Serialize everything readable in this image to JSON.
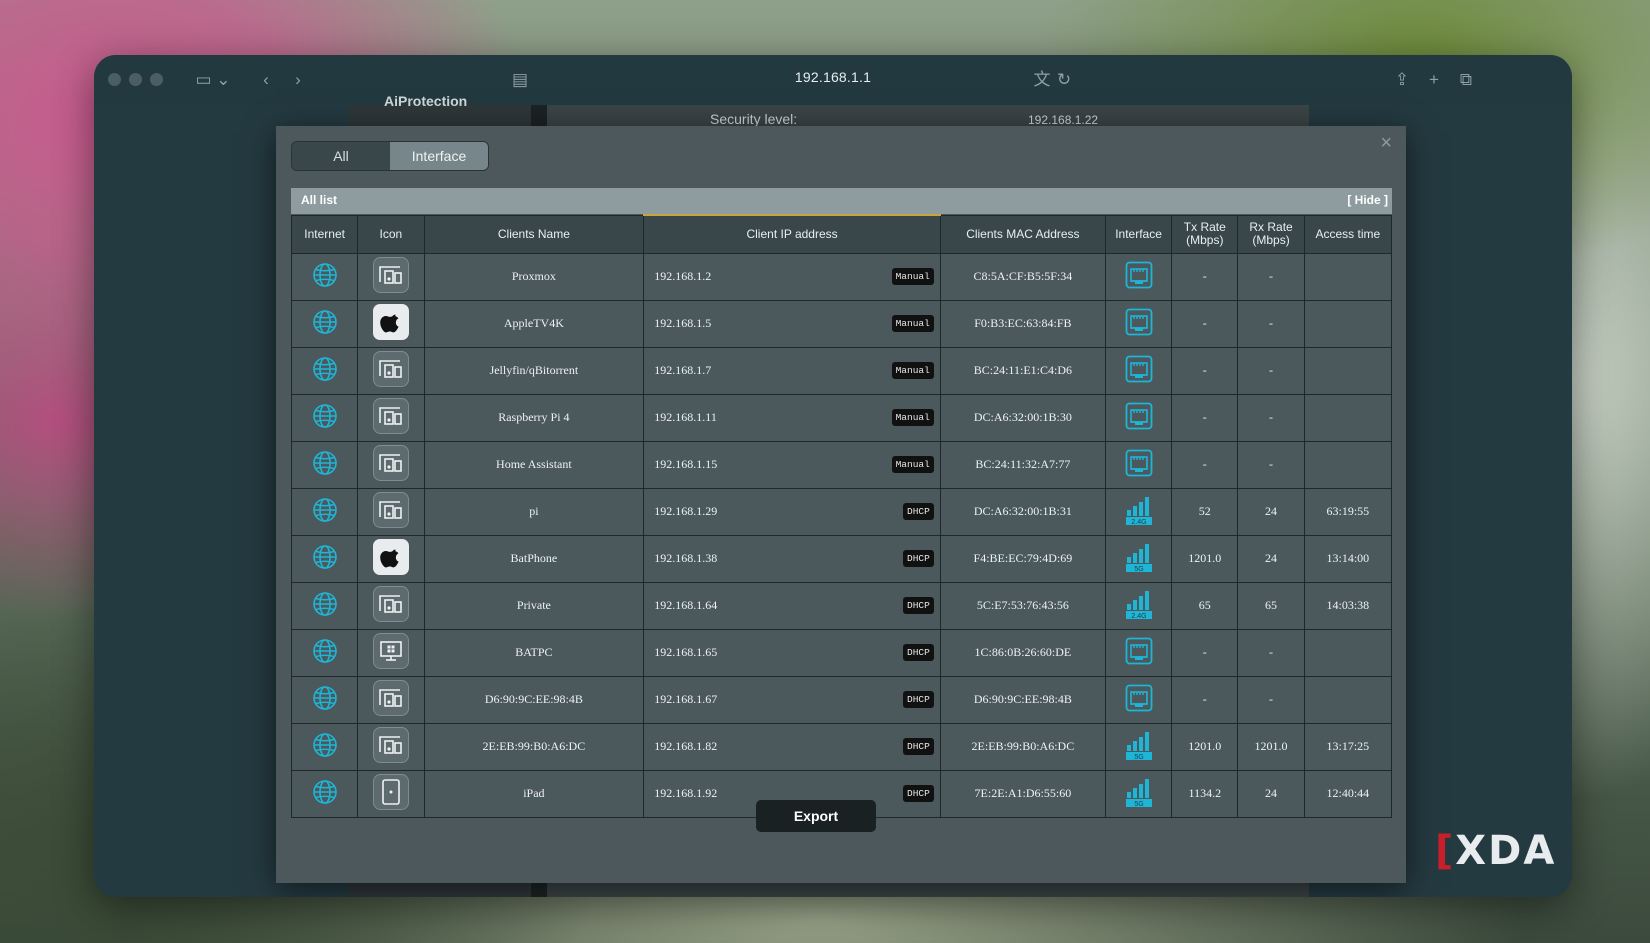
{
  "browser": {
    "url": "192.168.1.1"
  },
  "background_page": {
    "sidebar_item": "AiProtection",
    "security_label": "Security level:",
    "ip_fragment": "192.168.1.22"
  },
  "modal": {
    "tabs": [
      {
        "label": "All",
        "active": false
      },
      {
        "label": "Interface",
        "active": true
      }
    ],
    "list_title": "All list",
    "hide_label": "[ Hide ]",
    "export_label": "Export"
  },
  "table": {
    "headers": [
      "Internet",
      "Icon",
      "Clients Name",
      "Client IP address",
      "Clients MAC Address",
      "Interface",
      "Tx Rate (Mbps)",
      "Rx Rate (Mbps)",
      "Access time"
    ],
    "rows": [
      {
        "icon": "device-icon",
        "name": "Proxmox",
        "ip": "192.168.1.2",
        "mode": "Manual",
        "mac": "C8:5A:CF:B5:5F:34",
        "interface": "ethernet",
        "tx": "-",
        "rx": "-",
        "time": ""
      },
      {
        "icon": "apple-icon",
        "name": "AppleTV4K",
        "ip": "192.168.1.5",
        "mode": "Manual",
        "mac": "F0:B3:EC:63:84:FB",
        "interface": "ethernet",
        "tx": "-",
        "rx": "-",
        "time": ""
      },
      {
        "icon": "device-icon",
        "name": "Jellyfin/qBitorrent",
        "ip": "192.168.1.7",
        "mode": "Manual",
        "mac": "BC:24:11:E1:C4:D6",
        "interface": "ethernet",
        "tx": "-",
        "rx": "-",
        "time": ""
      },
      {
        "icon": "device-icon",
        "name": "Raspberry Pi 4",
        "ip": "192.168.1.11",
        "mode": "Manual",
        "mac": "DC:A6:32:00:1B:30",
        "interface": "ethernet",
        "tx": "-",
        "rx": "-",
        "time": ""
      },
      {
        "icon": "device-icon",
        "name": "Home Assistant",
        "ip": "192.168.1.15",
        "mode": "Manual",
        "mac": "BC:24:11:32:A7:77",
        "interface": "ethernet",
        "tx": "-",
        "rx": "-",
        "time": ""
      },
      {
        "icon": "device-icon",
        "name": "pi",
        "ip": "192.168.1.29",
        "mode": "DHCP",
        "mac": "DC:A6:32:00:1B:31",
        "interface": "wifi",
        "band": "2.4G",
        "tx": "52",
        "rx": "24",
        "time": "63:19:55"
      },
      {
        "icon": "apple-icon",
        "name": "BatPhone",
        "ip": "192.168.1.38",
        "mode": "DHCP",
        "mac": "F4:BE:EC:79:4D:69",
        "interface": "wifi",
        "band": "5G",
        "tx": "1201.0",
        "rx": "24",
        "time": "13:14:00"
      },
      {
        "icon": "device-icon",
        "name": "Private",
        "ip": "192.168.1.64",
        "mode": "DHCP",
        "mac": "5C:E7:53:76:43:56",
        "interface": "wifi",
        "band": "2.4G",
        "tx": "65",
        "rx": "65",
        "time": "14:03:38"
      },
      {
        "icon": "windows-pc-icon",
        "name": "BATPC",
        "ip": "192.168.1.65",
        "mode": "DHCP",
        "mac": "1C:86:0B:26:60:DE",
        "interface": "ethernet",
        "tx": "-",
        "rx": "-",
        "time": ""
      },
      {
        "icon": "device-icon",
        "name": "D6:90:9C:EE:98:4B",
        "ip": "192.168.1.67",
        "mode": "DHCP",
        "mac": "D6:90:9C:EE:98:4B",
        "interface": "ethernet",
        "tx": "-",
        "rx": "-",
        "time": ""
      },
      {
        "icon": "device-icon",
        "name": "2E:EB:99:B0:A6:DC",
        "ip": "192.168.1.82",
        "mode": "DHCP",
        "mac": "2E:EB:99:B0:A6:DC",
        "interface": "wifi",
        "band": "5G",
        "tx": "1201.0",
        "rx": "1201.0",
        "time": "13:17:25"
      },
      {
        "icon": "tablet-icon",
        "name": "iPad",
        "ip": "192.168.1.92",
        "mode": "DHCP",
        "mac": "7E:2E:A1:D6:55:60",
        "interface": "wifi",
        "band": "5G",
        "tx": "1134.2",
        "rx": "24",
        "time": "12:40:44"
      }
    ]
  },
  "watermark": "XDA",
  "colors": {
    "accent": "#1fb5d6",
    "modal_bg": "#4c585c",
    "header_bg": "#39474b"
  }
}
